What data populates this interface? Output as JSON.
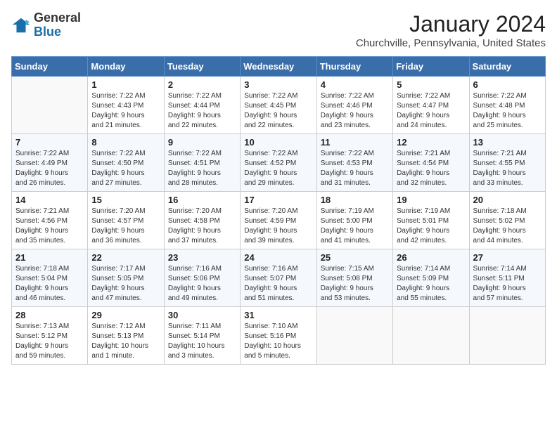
{
  "header": {
    "logo_line1": "General",
    "logo_line2": "Blue",
    "month": "January 2024",
    "location": "Churchville, Pennsylvania, United States"
  },
  "days_of_week": [
    "Sunday",
    "Monday",
    "Tuesday",
    "Wednesday",
    "Thursday",
    "Friday",
    "Saturday"
  ],
  "weeks": [
    [
      {
        "num": "",
        "info": ""
      },
      {
        "num": "1",
        "info": "Sunrise: 7:22 AM\nSunset: 4:43 PM\nDaylight: 9 hours\nand 21 minutes."
      },
      {
        "num": "2",
        "info": "Sunrise: 7:22 AM\nSunset: 4:44 PM\nDaylight: 9 hours\nand 22 minutes."
      },
      {
        "num": "3",
        "info": "Sunrise: 7:22 AM\nSunset: 4:45 PM\nDaylight: 9 hours\nand 22 minutes."
      },
      {
        "num": "4",
        "info": "Sunrise: 7:22 AM\nSunset: 4:46 PM\nDaylight: 9 hours\nand 23 minutes."
      },
      {
        "num": "5",
        "info": "Sunrise: 7:22 AM\nSunset: 4:47 PM\nDaylight: 9 hours\nand 24 minutes."
      },
      {
        "num": "6",
        "info": "Sunrise: 7:22 AM\nSunset: 4:48 PM\nDaylight: 9 hours\nand 25 minutes."
      }
    ],
    [
      {
        "num": "7",
        "info": "Sunrise: 7:22 AM\nSunset: 4:49 PM\nDaylight: 9 hours\nand 26 minutes."
      },
      {
        "num": "8",
        "info": "Sunrise: 7:22 AM\nSunset: 4:50 PM\nDaylight: 9 hours\nand 27 minutes."
      },
      {
        "num": "9",
        "info": "Sunrise: 7:22 AM\nSunset: 4:51 PM\nDaylight: 9 hours\nand 28 minutes."
      },
      {
        "num": "10",
        "info": "Sunrise: 7:22 AM\nSunset: 4:52 PM\nDaylight: 9 hours\nand 29 minutes."
      },
      {
        "num": "11",
        "info": "Sunrise: 7:22 AM\nSunset: 4:53 PM\nDaylight: 9 hours\nand 31 minutes."
      },
      {
        "num": "12",
        "info": "Sunrise: 7:21 AM\nSunset: 4:54 PM\nDaylight: 9 hours\nand 32 minutes."
      },
      {
        "num": "13",
        "info": "Sunrise: 7:21 AM\nSunset: 4:55 PM\nDaylight: 9 hours\nand 33 minutes."
      }
    ],
    [
      {
        "num": "14",
        "info": "Sunrise: 7:21 AM\nSunset: 4:56 PM\nDaylight: 9 hours\nand 35 minutes."
      },
      {
        "num": "15",
        "info": "Sunrise: 7:20 AM\nSunset: 4:57 PM\nDaylight: 9 hours\nand 36 minutes."
      },
      {
        "num": "16",
        "info": "Sunrise: 7:20 AM\nSunset: 4:58 PM\nDaylight: 9 hours\nand 37 minutes."
      },
      {
        "num": "17",
        "info": "Sunrise: 7:20 AM\nSunset: 4:59 PM\nDaylight: 9 hours\nand 39 minutes."
      },
      {
        "num": "18",
        "info": "Sunrise: 7:19 AM\nSunset: 5:00 PM\nDaylight: 9 hours\nand 41 minutes."
      },
      {
        "num": "19",
        "info": "Sunrise: 7:19 AM\nSunset: 5:01 PM\nDaylight: 9 hours\nand 42 minutes."
      },
      {
        "num": "20",
        "info": "Sunrise: 7:18 AM\nSunset: 5:02 PM\nDaylight: 9 hours\nand 44 minutes."
      }
    ],
    [
      {
        "num": "21",
        "info": "Sunrise: 7:18 AM\nSunset: 5:04 PM\nDaylight: 9 hours\nand 46 minutes."
      },
      {
        "num": "22",
        "info": "Sunrise: 7:17 AM\nSunset: 5:05 PM\nDaylight: 9 hours\nand 47 minutes."
      },
      {
        "num": "23",
        "info": "Sunrise: 7:16 AM\nSunset: 5:06 PM\nDaylight: 9 hours\nand 49 minutes."
      },
      {
        "num": "24",
        "info": "Sunrise: 7:16 AM\nSunset: 5:07 PM\nDaylight: 9 hours\nand 51 minutes."
      },
      {
        "num": "25",
        "info": "Sunrise: 7:15 AM\nSunset: 5:08 PM\nDaylight: 9 hours\nand 53 minutes."
      },
      {
        "num": "26",
        "info": "Sunrise: 7:14 AM\nSunset: 5:09 PM\nDaylight: 9 hours\nand 55 minutes."
      },
      {
        "num": "27",
        "info": "Sunrise: 7:14 AM\nSunset: 5:11 PM\nDaylight: 9 hours\nand 57 minutes."
      }
    ],
    [
      {
        "num": "28",
        "info": "Sunrise: 7:13 AM\nSunset: 5:12 PM\nDaylight: 9 hours\nand 59 minutes."
      },
      {
        "num": "29",
        "info": "Sunrise: 7:12 AM\nSunset: 5:13 PM\nDaylight: 10 hours\nand 1 minute."
      },
      {
        "num": "30",
        "info": "Sunrise: 7:11 AM\nSunset: 5:14 PM\nDaylight: 10 hours\nand 3 minutes."
      },
      {
        "num": "31",
        "info": "Sunrise: 7:10 AM\nSunset: 5:16 PM\nDaylight: 10 hours\nand 5 minutes."
      },
      {
        "num": "",
        "info": ""
      },
      {
        "num": "",
        "info": ""
      },
      {
        "num": "",
        "info": ""
      }
    ]
  ]
}
